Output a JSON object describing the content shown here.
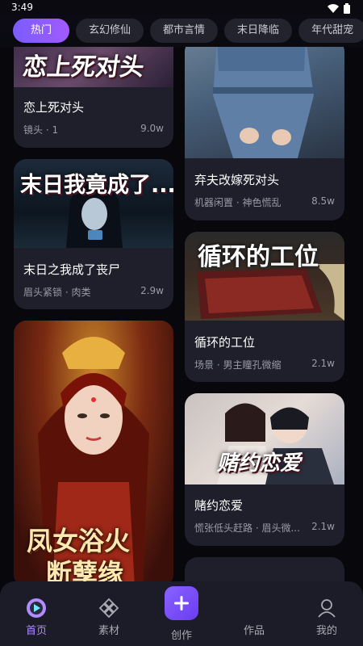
{
  "status_bar": {
    "time": "3:49"
  },
  "category_tabs": [
    "热门",
    "玄幻修仙",
    "都市言情",
    "末日降临",
    "年代甜宠"
  ],
  "cards": {
    "c1": {
      "title": "恋上死对头",
      "cover_text": "恋上死对头",
      "tags": "镜头 · 1",
      "views": "9.0w"
    },
    "c2": {
      "title": "弃夫改嫁死对头",
      "tags": "机器闲置 · 神色慌乱",
      "views": "8.5w"
    },
    "c3": {
      "title": "末日之我成了丧尸",
      "cover_text": "末日我竟成了...",
      "tags": "眉头紧锁 · 肉类",
      "views": "2.9w"
    },
    "c4": {
      "title": "循环的工位",
      "cover_text": "循环的工位",
      "tags": "场景 · 男主瞳孔微缩",
      "views": "2.1w"
    },
    "c5": {
      "cover_text_1": "凤女浴火",
      "cover_text_2": "断孽缘"
    },
    "c6": {
      "title": "赌约恋爱",
      "cover_text": "赌约恋爱",
      "tags": "慌张低头赶路 · 眉头微...",
      "views": "2.1w"
    }
  },
  "bottom_nav": {
    "home": "首页",
    "material": "素材",
    "create": "创作",
    "works": "作品",
    "mine": "我的"
  },
  "colors": {
    "accent": "#8a63ff",
    "card_bg": "#1e1f2b",
    "page_bg": "#08080c"
  }
}
